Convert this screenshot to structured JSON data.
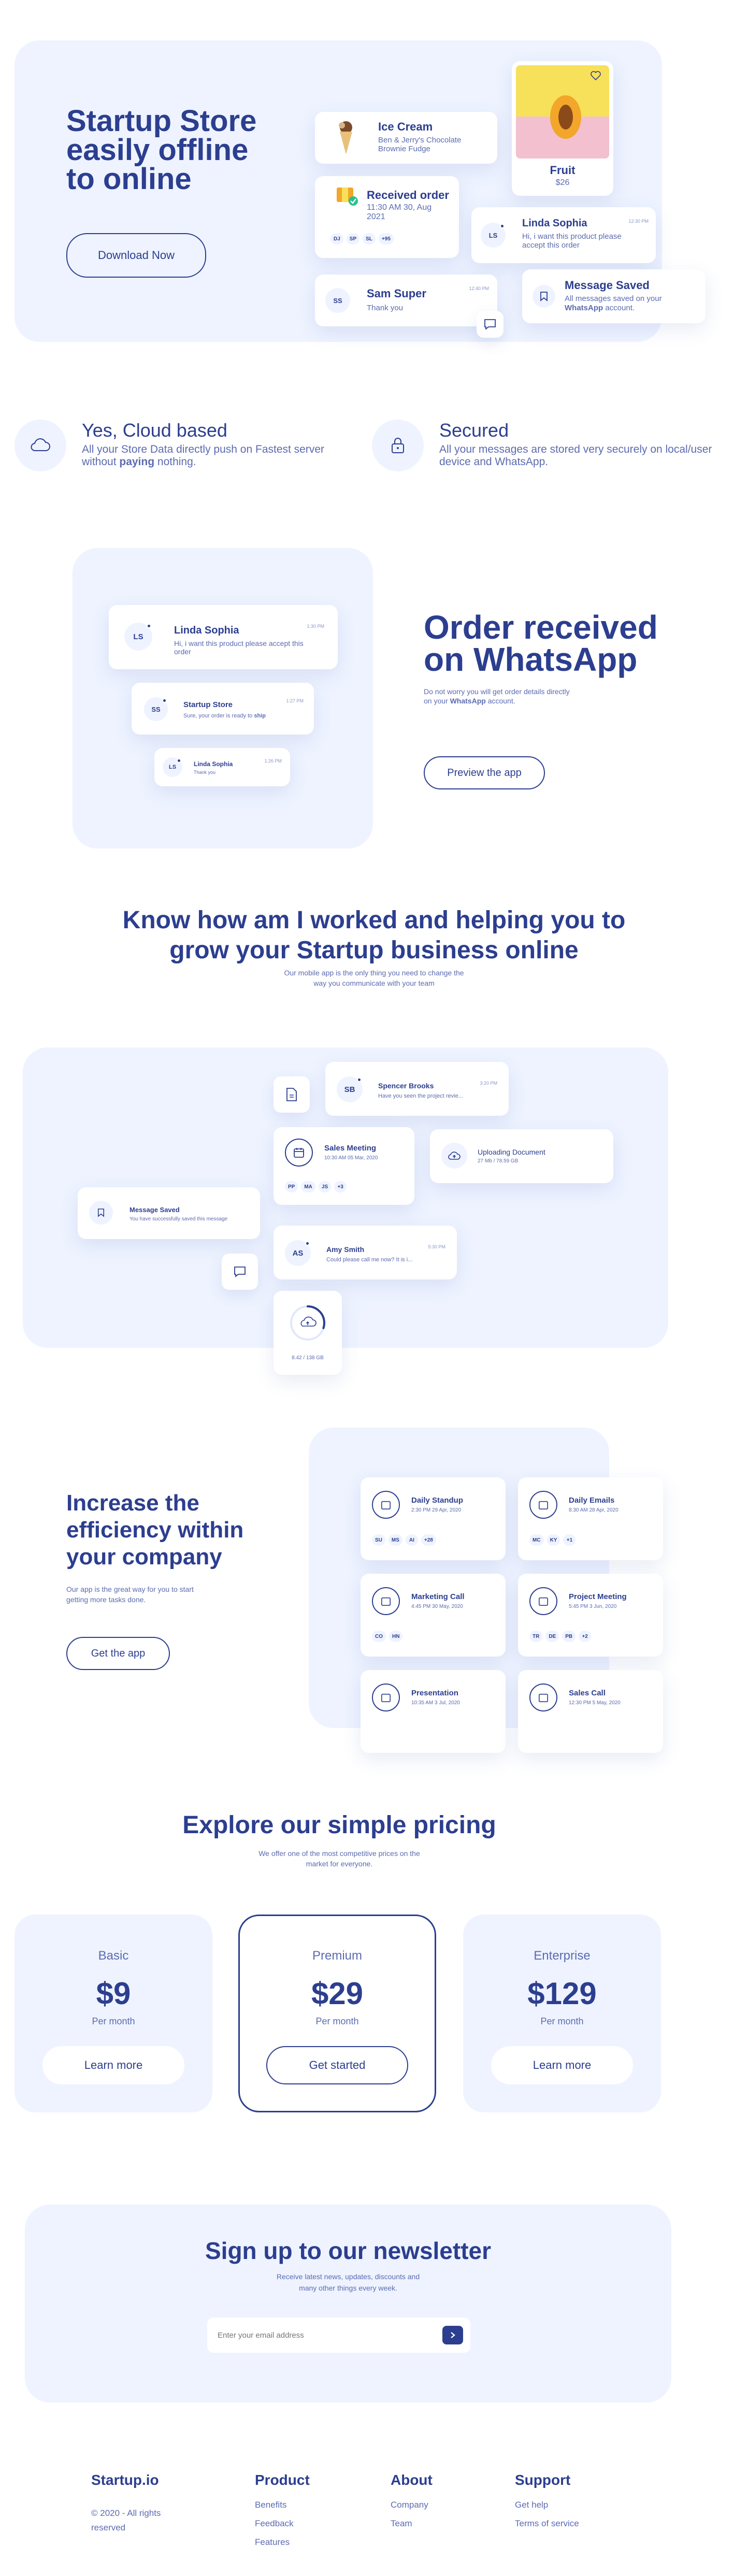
{
  "hero": {
    "title_line1": "Startup Store",
    "title_line2": "easily offline",
    "title_line3": "to online",
    "cta": "Download Now",
    "cards": {
      "ice_cream": {
        "title": "Ice Cream",
        "desc": "Ben & Jerry's Chocolate Brownie Fudge"
      },
      "fruit": {
        "title": "Fruit",
        "price": "$26"
      },
      "order": {
        "title": "Received order",
        "desc": "11:30 AM 30, Aug 2021",
        "chips": [
          "DJ",
          "SP",
          "SL",
          "+95"
        ]
      },
      "linda": {
        "initials": "LS",
        "name": "Linda Sophia",
        "time": "12:30 PM",
        "msg": "Hi, i want this product please accept this order"
      },
      "sam": {
        "initials": "SS",
        "name": "Sam Super",
        "time": "12:40 PM",
        "msg": "Thank you"
      },
      "saved": {
        "title": "Message Saved",
        "msg1": "All messages saved on your",
        "msg_bold": "WhatsApp",
        "msg2": "account."
      }
    }
  },
  "features": [
    {
      "icon": "cloud-icon",
      "title": "Yes, Cloud based",
      "desc1": "All your Store Data directly push on Fastest server without ",
      "desc_bold": "paying",
      "desc2": " nothing."
    },
    {
      "icon": "lock-icon",
      "title": "Secured",
      "desc": "All your messages are stored very securely on local/user device and WhatsApp."
    }
  ],
  "whatsapp": {
    "title_line1": "Order received",
    "title_line2": "on WhatsApp",
    "desc1": "Do not worry you will get order details directly on your ",
    "desc_bold": "WhatsApp",
    "desc2": " account.",
    "cta": "Preview the app",
    "cards": [
      {
        "initials": "LS",
        "name": "Linda Sophia",
        "time": "1:30 PM",
        "msg": "Hi, i want this product please accept this order"
      },
      {
        "initials": "SS",
        "name": "Startup Store",
        "time": "1:27 PM",
        "msg1": "Sure, your order is ready to ",
        "msg_bold": "ship",
        "msg2": ""
      },
      {
        "initials": "LS",
        "name": "Linda Sophia",
        "time": "1:26 PM",
        "msg": "Thank you"
      }
    ]
  },
  "how": {
    "title_line1": "Know how am I worked and helping you to",
    "title_line2": "grow your Startup business online",
    "desc_line1": "Our mobile app is the only thing you need to change the",
    "desc_line2": "way you communicate with your team"
  },
  "workflow": {
    "spencer": {
      "initials": "SB",
      "name": "Spencer Brooks",
      "time": "3:20 PM",
      "msg": "Have you seen the project revie..."
    },
    "meeting": {
      "title": "Sales Meeting",
      "time": "10:30 AM 05 Mar, 2020",
      "chips": [
        "PP",
        "MA",
        "JS",
        "+3"
      ]
    },
    "upload": {
      "title": "Uploading Document",
      "meta": "27 Mb / 78.59 GB"
    },
    "saved": {
      "title": "Message Saved",
      "msg": "You have successfully saved this message"
    },
    "amy": {
      "initials": "AS",
      "name": "Amy Smith",
      "time": "5:30 PM",
      "msg": "Could please call me now? It is i..."
    },
    "progress": {
      "label": "8.42 / 138 GB",
      "percent": 30
    }
  },
  "efficiency": {
    "title_line1": "Increase the",
    "title_line2": "efficiency within",
    "title_line3": "your company",
    "desc_line1": "Our app is the great way for you to start",
    "desc_line2": "getting more tasks done.",
    "cta": "Get the app",
    "tasks": [
      {
        "title": "Daily Standup",
        "time": "2:30 PM 29 Apr, 2020",
        "chips": [
          "SU",
          "MS",
          "AI",
          "+28"
        ]
      },
      {
        "title": "Daily Emails",
        "time": "8:30 AM 28 Apr, 2020",
        "chips": [
          "MC",
          "KY",
          "+1"
        ]
      },
      {
        "title": "Marketing Call",
        "time": "4:45 PM 30 May, 2020",
        "chips": [
          "CO",
          "HN"
        ]
      },
      {
        "title": "Project Meeting",
        "time": "5:45 PM 3 Jun, 2020",
        "chips": [
          "TR",
          "DE",
          "PB",
          "+2"
        ]
      },
      {
        "title": "Presentation",
        "time": "10:35 AM 3 Jul, 2020",
        "chips": []
      },
      {
        "title": "Sales Call",
        "time": "12:30 PM 5 May, 2020",
        "chips": []
      }
    ]
  },
  "pricing": {
    "title": "Explore our simple pricing",
    "desc_line1": "We offer one of the most competitive prices on the",
    "desc_line2": "market for everyone.",
    "plans": [
      {
        "name": "Basic",
        "price": "$9",
        "period": "Per month",
        "cta": "Learn more"
      },
      {
        "name": "Premium",
        "price": "$29",
        "period": "Per month",
        "cta": "Get started"
      },
      {
        "name": "Enterprise",
        "price": "$129",
        "period": "Per month",
        "cta": "Learn more"
      }
    ]
  },
  "newsletter": {
    "title": "Sign up to our newsletter",
    "desc_line1": "Receive latest news, updates, discounts and",
    "desc_line2": "many other things every week.",
    "placeholder": "Enter your email address"
  },
  "footer": {
    "brand": "Startup.io",
    "copyright_line1": "© 2020 - All rights",
    "copyright_line2": "reserved",
    "columns": [
      {
        "title": "Product",
        "links": [
          "Benefits",
          "Feedback",
          "Features"
        ]
      },
      {
        "title": "About",
        "links": [
          "Company",
          "Team"
        ]
      },
      {
        "title": "Support",
        "links": [
          "Get help",
          "Terms of service"
        ]
      }
    ]
  },
  "colors": {
    "primary": "#2c3e8f",
    "panel": "#eef3ff",
    "accent_pink": "#f3c0d0",
    "accent_yellow": "#f7e05a"
  }
}
